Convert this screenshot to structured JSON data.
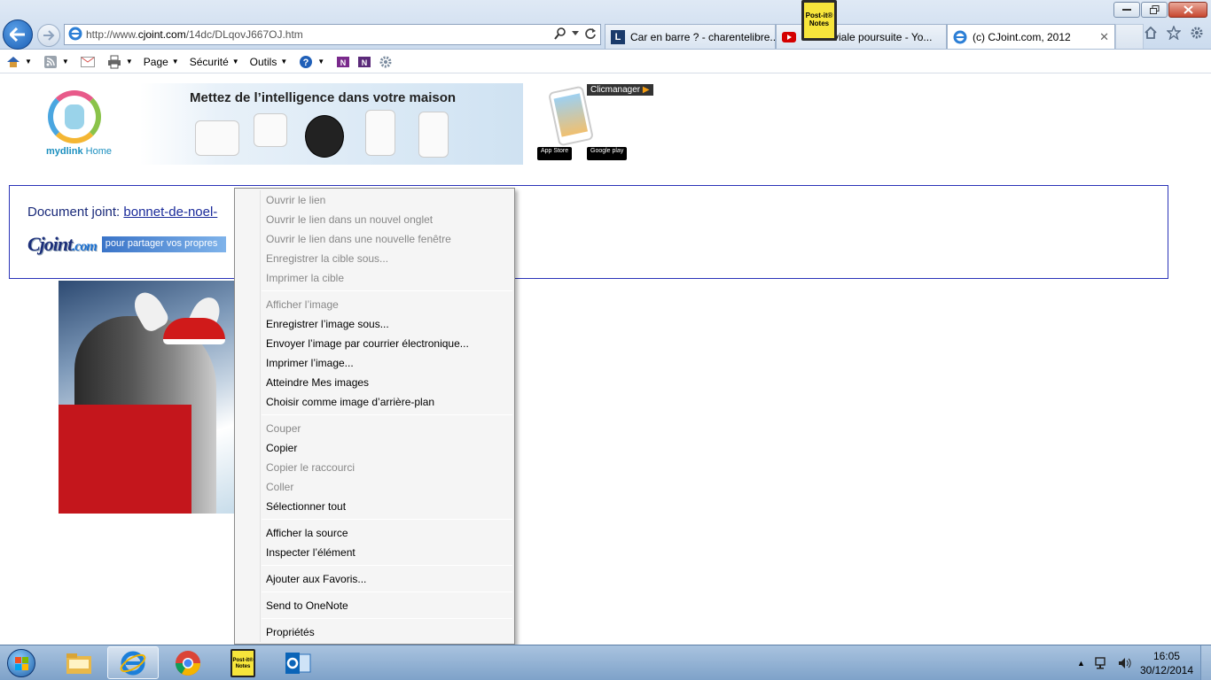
{
  "browser": {
    "address": {
      "url_prefix": "http://www.",
      "url_domain": "cjoint.com",
      "url_path": "/14dc/DLqovJ667OJ.htm"
    },
    "tabs": [
      {
        "label": "Car en barre ? - charentelibre....",
        "icon": "charentelibre-icon"
      },
      {
        "label": "T... a...viale poursuite - Yo...",
        "icon": "youtube-icon"
      },
      {
        "label": "(c) CJoint.com, 2012",
        "icon": "ie-page-icon"
      }
    ],
    "floating_widget": {
      "line1": "Post-it®",
      "line2": "Notes"
    },
    "commands": {
      "page": "Page",
      "security": "Sécurité",
      "tools": "Outils"
    }
  },
  "page": {
    "banner": {
      "brand": "mydlink",
      "brand_suffix": " Home",
      "headline": "Mettez de l’intelligence dans votre maison",
      "clicmanager": "Clicmanager",
      "app_store": "App Store",
      "google_play": "Google play"
    },
    "attachment": {
      "label": "Document joint: ",
      "link": "bonnet-de-noel-",
      "cjoint_logo": "Cjoint",
      "cjoint_suffix": ".com",
      "cjoint_tagline": "pour partager vos propres"
    }
  },
  "context_menu": {
    "groups": [
      [
        {
          "label": "Ouvrir le lien",
          "enabled": false
        },
        {
          "label": "Ouvrir le lien dans un nouvel onglet",
          "enabled": false
        },
        {
          "label": "Ouvrir le lien dans une nouvelle fenêtre",
          "enabled": false
        },
        {
          "label": "Enregistrer la cible sous...",
          "enabled": false
        },
        {
          "label": "Imprimer la cible",
          "enabled": false
        }
      ],
      [
        {
          "label": "Afficher l’image",
          "enabled": false
        },
        {
          "label": "Enregistrer l’image sous...",
          "enabled": true
        },
        {
          "label": "Envoyer l’image par courrier électronique...",
          "enabled": true
        },
        {
          "label": "Imprimer l’image...",
          "enabled": true
        },
        {
          "label": "Atteindre Mes images",
          "enabled": true
        },
        {
          "label": "Choisir comme image d’arrière-plan",
          "enabled": true
        }
      ],
      [
        {
          "label": "Couper",
          "enabled": false
        },
        {
          "label": "Copier",
          "enabled": true
        },
        {
          "label": "Copier le raccourci",
          "enabled": false
        },
        {
          "label": "Coller",
          "enabled": false
        },
        {
          "label": "Sélectionner tout",
          "enabled": true
        }
      ],
      [
        {
          "label": "Afficher la source",
          "enabled": true
        },
        {
          "label": "Inspecter l’élément",
          "enabled": true
        }
      ],
      [
        {
          "label": "Ajouter aux Favoris...",
          "enabled": true
        }
      ],
      [
        {
          "label": "Send to OneNote",
          "enabled": true
        }
      ],
      [
        {
          "label": "Propriétés",
          "enabled": true
        }
      ]
    ]
  },
  "taskbar": {
    "apps": [
      "file-explorer-icon",
      "internet-explorer-icon",
      "chrome-icon",
      "post-it-notes-icon",
      "outlook-icon"
    ],
    "active_app": "internet-explorer-icon",
    "postit_label": "Post-it® Notes",
    "clock": {
      "time": "16:05",
      "date": "30/12/2014"
    }
  },
  "colors": {
    "accent": "#1b5fb4",
    "link": "#1a2a9a",
    "border_box": "#2a33b8",
    "menu_disabled": "#888888"
  }
}
